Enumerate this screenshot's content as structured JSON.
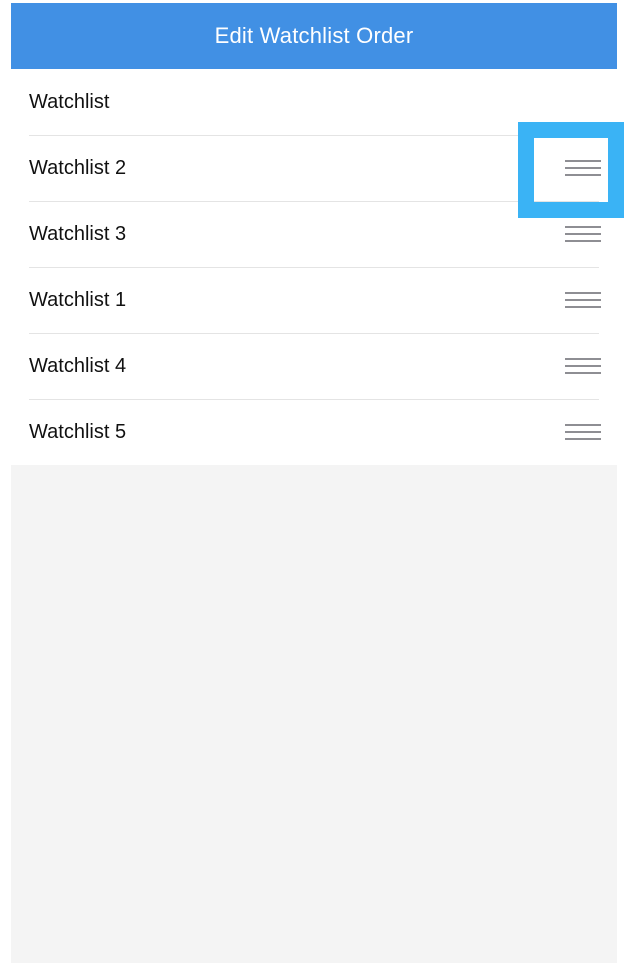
{
  "header": {
    "title": "Edit Watchlist Order",
    "background": "#4190e4"
  },
  "watchlists": [
    {
      "label": "Watchlist",
      "has_drag_handle": false
    },
    {
      "label": "Watchlist 2",
      "has_drag_handle": true,
      "highlighted": true
    },
    {
      "label": "Watchlist 3",
      "has_drag_handle": true
    },
    {
      "label": "Watchlist 1",
      "has_drag_handle": true
    },
    {
      "label": "Watchlist 4",
      "has_drag_handle": true
    },
    {
      "label": "Watchlist 5",
      "has_drag_handle": true
    }
  ],
  "icons": {
    "drag_handle": "drag-handle-icon"
  },
  "colors": {
    "highlight": "#3ab3f5",
    "empty_area": "#f4f4f4"
  }
}
